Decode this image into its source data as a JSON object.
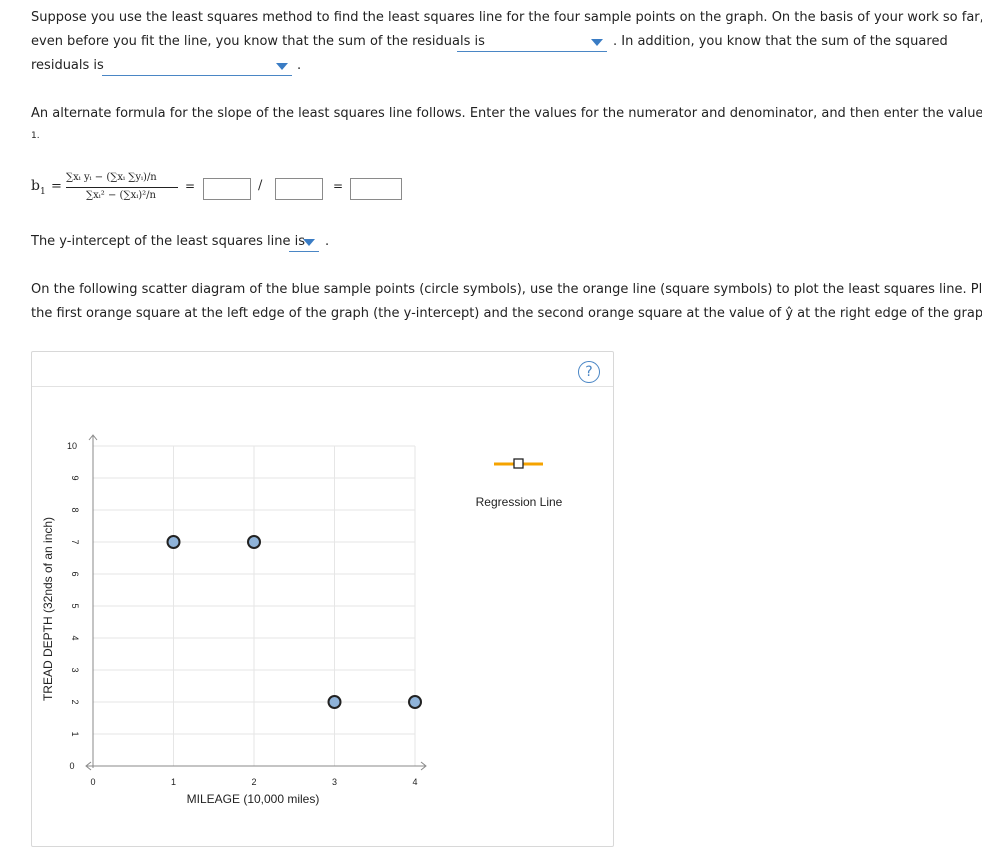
{
  "para1": {
    "line1": "Suppose you use the least squares method to find the least squares line for the four sample points on the graph. On the basis of your work so far,",
    "line2a": "even before you fit the line, you know that the sum of the residuals is",
    "line2b": ". In addition, you know that the sum of the squared",
    "line3a": "residuals is",
    "line3b": "."
  },
  "para2": {
    "line1": "An alternate formula for the slope of the least squares line follows. Enter the values for the numerator and denominator, and then enter the value of b",
    "line2": "1",
    "line2end": "."
  },
  "formula": {
    "lhs": "b",
    "lhs_sub": "1",
    "eq": "=",
    "numerator": "∑xᵢ yᵢ − (∑xᵢ ∑yᵢ)/n",
    "denominator": "∑xᵢ² − (∑xᵢ)²/n",
    "eq2": "=",
    "slash": "/",
    "eq3": "="
  },
  "intercept": {
    "label": "The y-intercept of the least squares line is",
    "end": "."
  },
  "para3": {
    "line1": "On the following scatter diagram of the blue sample points (circle symbols), use the orange line (square symbols) to plot the least squares line. Place",
    "line2": "the first orange square at the left edge of the graph (the y-intercept) and the second orange square at the value of ŷ at the right edge of the graph."
  },
  "help_icon": "?",
  "legend": {
    "label": "Regression Line",
    "color": "#f5a300"
  },
  "chart_data": {
    "type": "scatter",
    "xlabel": "MILEAGE (10,000 miles)",
    "ylabel": "TREAD DEPTH (32nds of an inch)",
    "xlim": [
      0,
      4
    ],
    "ylim": [
      0,
      10
    ],
    "x_ticks": [
      "0",
      "1",
      "2",
      "3",
      "4"
    ],
    "y_ticks": [
      "0",
      "1",
      "2",
      "3",
      "4",
      "5",
      "6",
      "7",
      "8",
      "9",
      "10"
    ],
    "grid": true,
    "point_color": "#8fb3d9",
    "points": [
      {
        "x": 1,
        "y": 7
      },
      {
        "x": 2,
        "y": 7
      },
      {
        "x": 3,
        "y": 2
      },
      {
        "x": 4,
        "y": 2
      }
    ]
  }
}
